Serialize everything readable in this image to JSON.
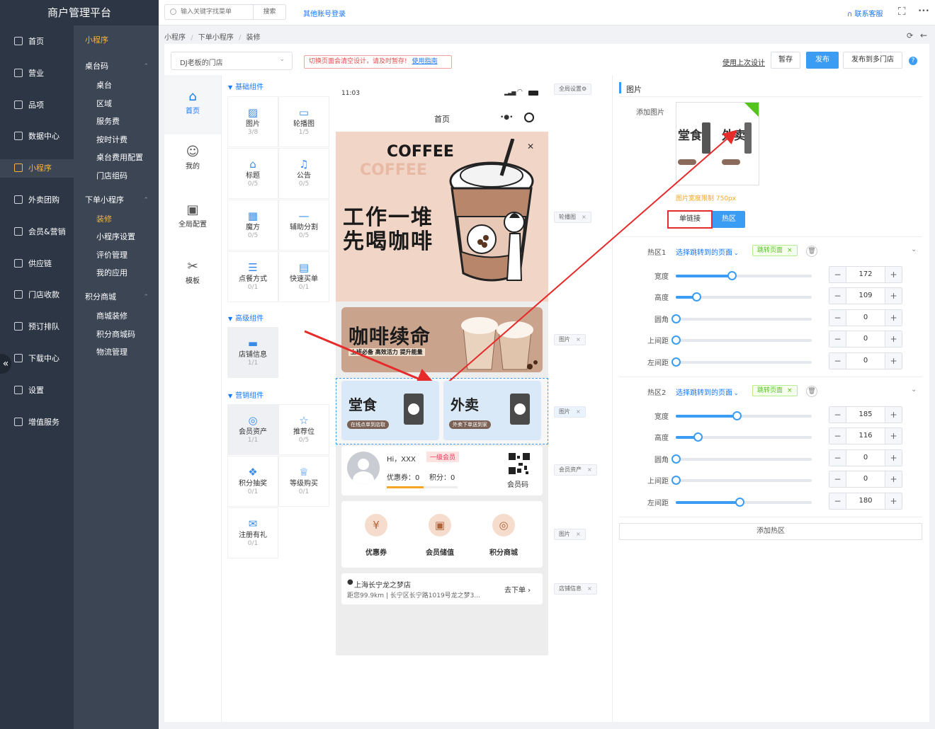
{
  "brand": {
    "title": "商户管理平台"
  },
  "nav_primary": [
    {
      "label": "首页",
      "active": false
    },
    {
      "label": "营业",
      "active": false
    },
    {
      "label": "品项",
      "active": false
    },
    {
      "label": "数据中心",
      "active": false
    },
    {
      "label": "小程序",
      "active": true
    },
    {
      "label": "外卖团购",
      "active": false
    },
    {
      "label": "会员&营销",
      "active": false
    },
    {
      "label": "供应链",
      "active": false
    },
    {
      "label": "门店收款",
      "active": false
    },
    {
      "label": "预订排队",
      "active": false
    },
    {
      "label": "下载中心",
      "active": false
    },
    {
      "label": "设置",
      "active": false
    },
    {
      "label": "增值服务",
      "active": false
    }
  ],
  "nav_secondary": {
    "title": "小程序",
    "sections": [
      {
        "label": "桌台码",
        "items": [
          "桌台",
          "区域",
          "服务费",
          "按时计费",
          "桌台费用配置",
          "门店组码"
        ]
      },
      {
        "label": "下单小程序",
        "items": [
          "装修",
          "小程序设置",
          "评价管理",
          "我的应用"
        ]
      },
      {
        "label": "积分商城",
        "items": [
          "商城装修",
          "积分商城码",
          "物流管理"
        ]
      }
    ],
    "active_item": "装修"
  },
  "collapse_label": "«",
  "topbar": {
    "search_placeholder": "输入关键字找菜单",
    "search_button": "搜索",
    "other_login": "其他账号登录",
    "support": "联系客服",
    "fullscreen_glyph": "⛶",
    "more_glyph": "•••"
  },
  "breadcrumb": [
    "小程序",
    "下单小程序",
    "装修"
  ],
  "toolbar": {
    "store_select": "DJ老板的门店",
    "warning_text": "切换页面会清空设计，请及时暂存!",
    "warning_link": "使用指南",
    "use_last_design": "使用上次设计",
    "save_draft": "暂存",
    "publish": "发布",
    "publish_multi": "发布到多门店",
    "help": "?"
  },
  "page_tabs": [
    {
      "label": "首页",
      "icon": "⌂",
      "active": true
    },
    {
      "label": "我的",
      "icon": "☺",
      "active": false
    },
    {
      "label": "全局配置",
      "icon": "▣",
      "active": false
    },
    {
      "label": "模板",
      "icon": "✂",
      "active": false
    }
  ],
  "component_groups": [
    {
      "title": "基础组件",
      "items": [
        {
          "label": "图片",
          "count": "3/8",
          "icon": "▨"
        },
        {
          "label": "轮播图",
          "count": "1/5",
          "icon": "▭"
        },
        {
          "label": "标题",
          "count": "0/5",
          "icon": "⌂"
        },
        {
          "label": "公告",
          "count": "0/5",
          "icon": "♫"
        },
        {
          "label": "魔方",
          "count": "0/5",
          "icon": "▦"
        },
        {
          "label": "辅助分割",
          "count": "0/5",
          "icon": "—"
        },
        {
          "label": "点餐方式",
          "count": "0/1",
          "icon": "☰"
        },
        {
          "label": "快速买单",
          "count": "0/1",
          "icon": "▤"
        }
      ]
    },
    {
      "title": "高级组件",
      "items": [
        {
          "label": "店铺信息",
          "count": "1/1",
          "icon": "▬"
        }
      ]
    },
    {
      "title": "营销组件",
      "items": [
        {
          "label": "会员资产",
          "count": "1/1",
          "icon": "◎"
        },
        {
          "label": "推荐位",
          "count": "0/5",
          "icon": "☆"
        },
        {
          "label": "积分抽奖",
          "count": "0/1",
          "icon": "❖"
        },
        {
          "label": "等级购买",
          "count": "0/1",
          "icon": "♕"
        },
        {
          "label": "注册有礼",
          "count": "0/1",
          "icon": "✉"
        }
      ]
    }
  ],
  "phone": {
    "time": "11:03",
    "title": "首页",
    "banner": {
      "heading": "COFFEE",
      "heading_shadow": "COFFEE",
      "line1": "工作一堆",
      "line2": "先喝咖啡"
    },
    "banner2": {
      "text": "咖啡续命",
      "sub": "上班必备 高效活力 提升能量"
    },
    "tiles": [
      {
        "title": "堂食",
        "pill": "在线点单到店取"
      },
      {
        "title": "外卖",
        "pill": "外卖下单送到家"
      }
    ],
    "member": {
      "greeting": "Hi，XXX",
      "level": "一级会员",
      "coupons": "优惠券：0",
      "points": "积分：0",
      "qr_label": "会员码"
    },
    "quick_links": [
      {
        "label": "优惠券",
        "icon": "¥"
      },
      {
        "label": "会员储值",
        "icon": "▣"
      },
      {
        "label": "积分商城",
        "icon": "◎"
      }
    ],
    "store": {
      "name": "上海长宁龙之梦店",
      "address": "距您99.9km | 长宁区长宁路1019号龙之梦3...",
      "cta": "去下单 ›"
    }
  },
  "side_tags": [
    "全局设置⚙",
    "轮播图",
    "图片",
    "图片",
    "会员资产",
    "图片",
    "店铺信息"
  ],
  "panel": {
    "title": "图片",
    "add_image_label": "添加图片",
    "preview": {
      "left": "堂食",
      "right": "外卖"
    },
    "image_hint": "图片宽度限制 750px",
    "mode_tabs": [
      {
        "label": "单链接",
        "active": false
      },
      {
        "label": "热区",
        "active": true
      }
    ],
    "hotspots": [
      {
        "label": "热区1",
        "link_select": "选择跳转到的页面",
        "tag": "跳转页面",
        "fields": [
          {
            "label": "宽度",
            "value": 172,
            "pct": 0.41
          },
          {
            "label": "高度",
            "value": 109,
            "pct": 0.15
          },
          {
            "label": "圆角",
            "value": 0,
            "pct": 0
          },
          {
            "label": "上间距",
            "value": 0,
            "pct": 0
          },
          {
            "label": "左间距",
            "value": 0,
            "pct": 0
          }
        ]
      },
      {
        "label": "热区2",
        "link_select": "选择跳转到的页面",
        "tag": "跳转页面",
        "fields": [
          {
            "label": "宽度",
            "value": 185,
            "pct": 0.45
          },
          {
            "label": "高度",
            "value": 116,
            "pct": 0.16
          },
          {
            "label": "圆角",
            "value": 0,
            "pct": 0
          },
          {
            "label": "上间距",
            "value": 0,
            "pct": 0
          },
          {
            "label": "左间距",
            "value": 180,
            "pct": 0.47
          }
        ]
      }
    ],
    "add_hotspot": "添加热区"
  },
  "colors": {
    "accent": "#1677ff",
    "primary_btn": "#3a9cf3",
    "nav_active": "#f6b23c",
    "annotation": "#e62b2b"
  }
}
